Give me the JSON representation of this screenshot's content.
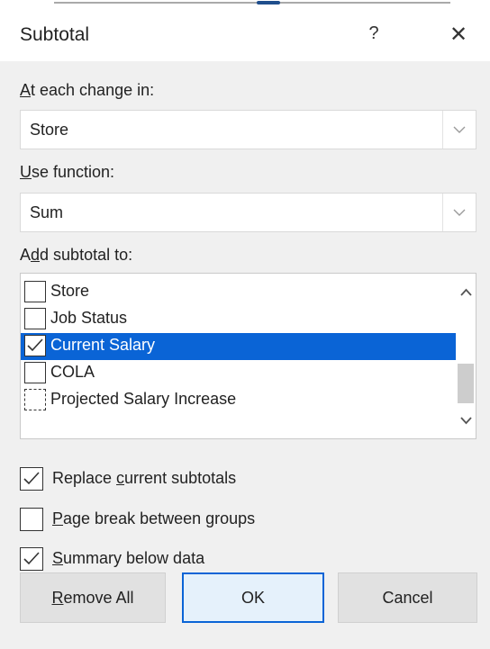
{
  "dialog": {
    "title": "Subtotal",
    "help_label": "?",
    "close_label": "✕"
  },
  "change_in": {
    "label_accel": "A",
    "label_rest": "t each change in:",
    "value": "Store"
  },
  "use_function": {
    "label_accel": "U",
    "label_rest": "se function:",
    "value": "Sum"
  },
  "add_subtotal": {
    "label_pre": "A",
    "label_accel": "d",
    "label_rest": "d subtotal to:",
    "items": [
      {
        "label": "Store",
        "checked": false
      },
      {
        "label": "Job Status",
        "checked": false
      },
      {
        "label": "Current Salary",
        "checked": true,
        "selected": true
      },
      {
        "label": "COLA",
        "checked": false
      },
      {
        "label": "Projected Salary Increase",
        "checked": false
      }
    ]
  },
  "options": {
    "replace": {
      "pre": "Replace ",
      "accel": "c",
      "rest": "urrent subtotals",
      "checked": true
    },
    "page_break": {
      "pre": "",
      "accel": "P",
      "rest": "age break between groups",
      "checked": false
    },
    "summary": {
      "pre": "",
      "accel": "S",
      "rest": "ummary below data",
      "checked": true
    }
  },
  "buttons": {
    "remove_accel": "R",
    "remove_rest": "emove All",
    "ok": "OK",
    "cancel": "Cancel"
  },
  "colors": {
    "selection": "#0a64d6",
    "dialog_bg": "#f0f0f0"
  }
}
